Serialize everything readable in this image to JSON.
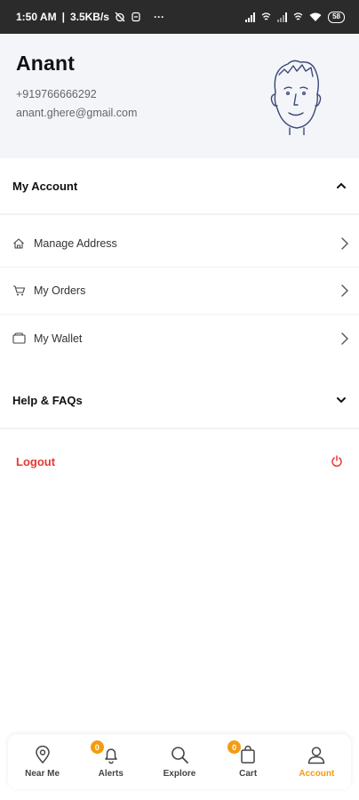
{
  "status_bar": {
    "time": "1:50 AM",
    "network_speed": "3.5KB/s",
    "more": "···",
    "battery": "58"
  },
  "profile": {
    "name": "Anant",
    "phone": "+919766666292",
    "email": "anant.ghere@gmail.com"
  },
  "my_account": {
    "title": "My Account",
    "items": [
      {
        "label": "Manage Address",
        "icon": "home-icon"
      },
      {
        "label": "My Orders",
        "icon": "cart-icon"
      },
      {
        "label": "My Wallet",
        "icon": "wallet-icon"
      }
    ]
  },
  "help": {
    "title": "Help & FAQs"
  },
  "logout": {
    "label": "Logout",
    "color": "#e53935"
  },
  "bottom_nav": {
    "accent_color": "#f39c12",
    "items": [
      {
        "label": "Near Me",
        "icon": "location-pin-icon"
      },
      {
        "label": "Alerts",
        "icon": "bell-icon",
        "badge": "0"
      },
      {
        "label": "Explore",
        "icon": "search-icon"
      },
      {
        "label": "Cart",
        "icon": "bag-icon",
        "badge": "0"
      },
      {
        "label": "Account",
        "icon": "user-icon",
        "active": true
      }
    ]
  }
}
